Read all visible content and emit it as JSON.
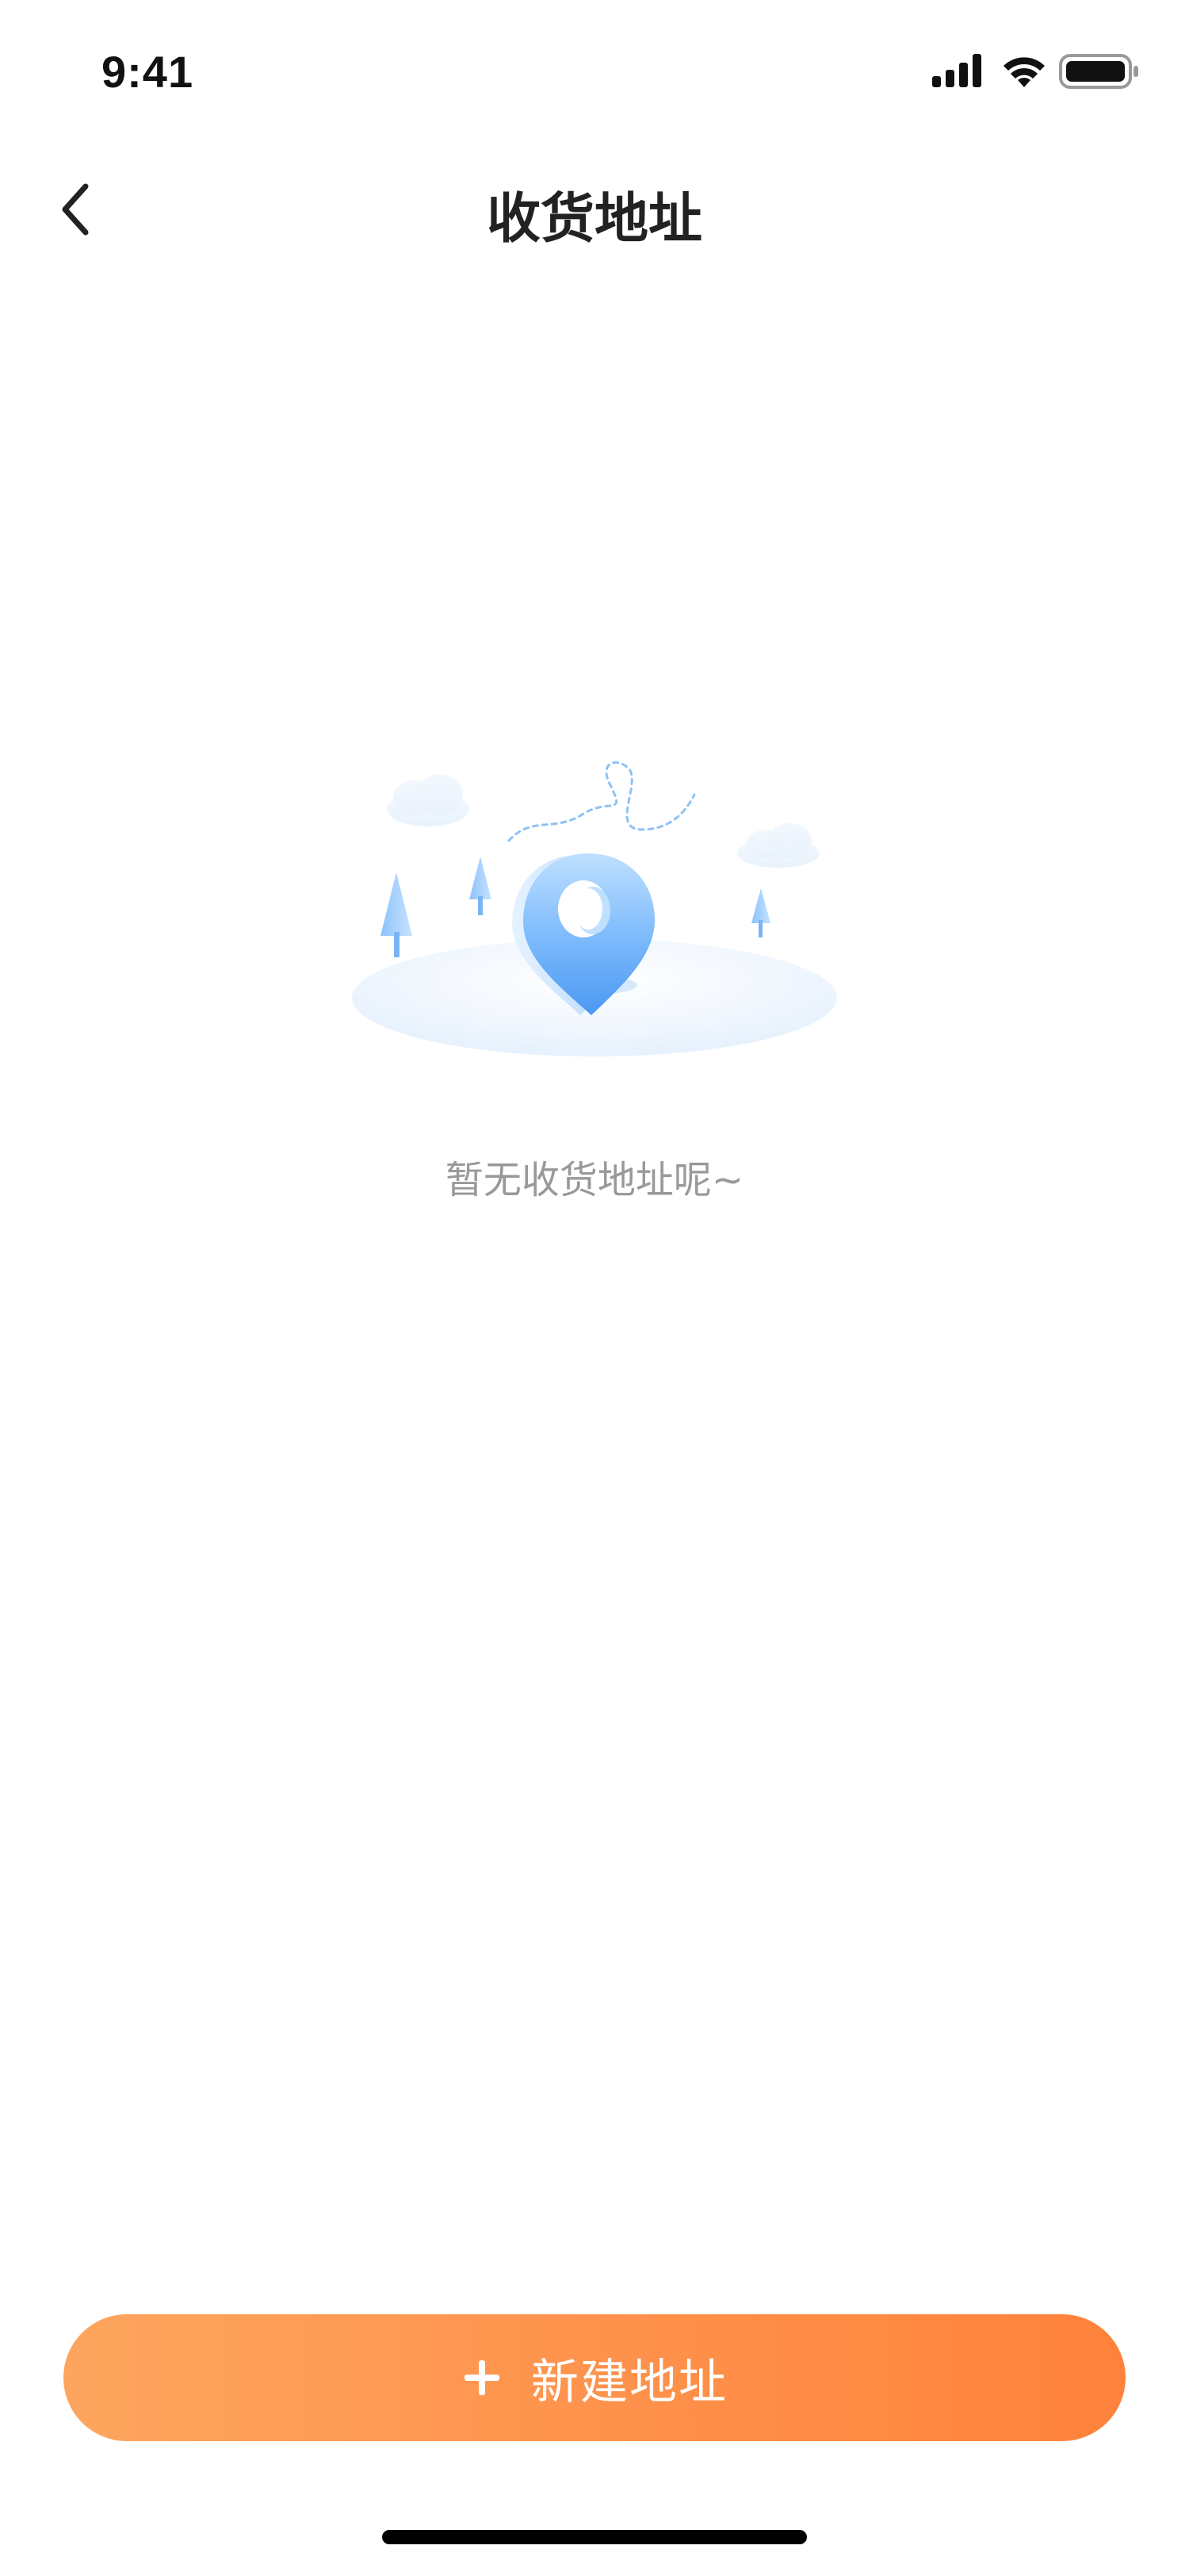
{
  "status_bar": {
    "time": "9:41",
    "icons": [
      "signal-icon",
      "wifi-icon",
      "battery-icon"
    ]
  },
  "nav": {
    "back_icon": "chevron-left-icon",
    "title": "收货地址"
  },
  "empty_state": {
    "illustration": "location-pin-illustration",
    "message": "暂无收货地址呢~"
  },
  "footer": {
    "add_icon": "plus-icon",
    "add_label": "新建地址"
  },
  "colors": {
    "accent_start": "#fda55e",
    "accent_end": "#fe823b",
    "pin_blue": "#5aa8f8",
    "text_muted": "#999999",
    "title": "#222222"
  }
}
